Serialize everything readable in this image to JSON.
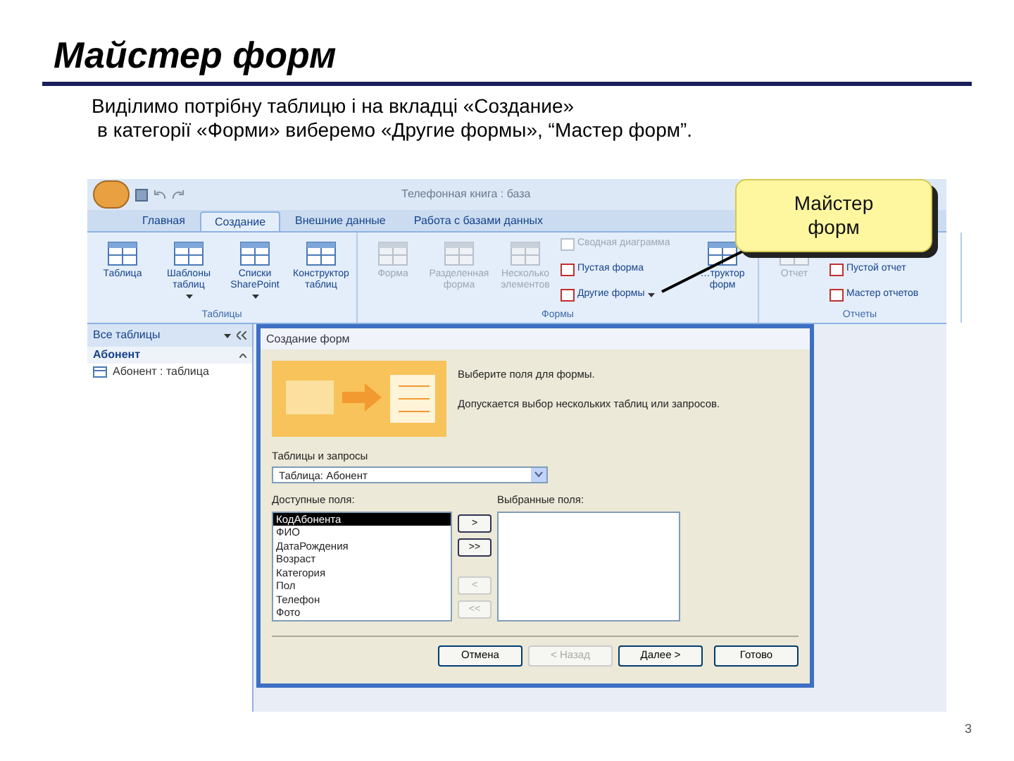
{
  "slide": {
    "title": "Майстер форм",
    "intro": [
      "Виділимо потрібну таблицю і на вкладці «Создание»",
      "в категорії «Форми» виберемо «Другие формы», “Мастер форм”."
    ],
    "page_number": "3"
  },
  "app": {
    "window_title": "Телефонная книга : база",
    "tabs": [
      {
        "label": "Главная",
        "selected": false
      },
      {
        "label": "Создание",
        "selected": true
      },
      {
        "label": "Внешние данные",
        "selected": false
      },
      {
        "label": "Работа с базами данных",
        "selected": false
      }
    ],
    "groups": [
      {
        "label": "Таблицы",
        "buttons": [
          {
            "label": "Таблица",
            "kind": "large",
            "disabled": false,
            "has_menu": false
          },
          {
            "label": "Шаблоны таблиц",
            "kind": "large",
            "disabled": false,
            "has_menu": true
          },
          {
            "label": "Списки SharePoint",
            "kind": "large",
            "disabled": false,
            "has_menu": true
          },
          {
            "label": "Конструктор таблиц",
            "kind": "large",
            "disabled": false,
            "has_menu": false
          }
        ]
      },
      {
        "label": "Формы",
        "buttons": [
          {
            "label": "Форма",
            "kind": "large",
            "disabled": true,
            "has_menu": false
          },
          {
            "label": "Разделенная форма",
            "kind": "large",
            "disabled": true,
            "has_menu": false
          },
          {
            "label": "Несколько элементов",
            "kind": "large",
            "disabled": true,
            "has_menu": false
          },
          {
            "label": "Сводная диаграмма",
            "kind": "small",
            "disabled": true,
            "has_menu": false
          },
          {
            "label": "Пустая форма",
            "kind": "small",
            "disabled": false,
            "has_menu": false
          },
          {
            "label": "Другие формы",
            "kind": "small",
            "disabled": false,
            "has_menu": true
          },
          {
            "label": "…труктор форм",
            "kind": "large",
            "disabled": false,
            "has_menu": false
          }
        ]
      },
      {
        "label": "Отчеты",
        "buttons": [
          {
            "label": "Отчет",
            "kind": "large",
            "disabled": true,
            "has_menu": false
          },
          {
            "label": "Пустой отчет",
            "kind": "small",
            "disabled": false,
            "has_menu": false
          },
          {
            "label": "Мастер отчетов",
            "kind": "small",
            "disabled": false,
            "has_menu": false
          }
        ]
      }
    ]
  },
  "callout": {
    "text": "Майстер форм"
  },
  "nav": {
    "title": "Все таблицы",
    "group": "Абонент",
    "item": "Абонент : таблица"
  },
  "dialog": {
    "title": "Создание форм",
    "prompt": "Выберите поля для формы.",
    "hint": "Допускается выбор нескольких таблиц или запросов.",
    "source_label": "Таблицы и запросы",
    "source_value": "Таблица: Абонент",
    "available_label": "Доступные поля:",
    "selected_label": "Выбранные поля:",
    "available_fields": [
      {
        "label": "КодАбонента",
        "selected": true
      },
      {
        "label": "ФИО",
        "selected": false
      },
      {
        "label": "ДатаРождения",
        "selected": false
      },
      {
        "label": "Возраст",
        "selected": false
      },
      {
        "label": "Категория",
        "selected": false
      },
      {
        "label": "Пол",
        "selected": false
      },
      {
        "label": "Телефон",
        "selected": false
      },
      {
        "label": "Фото",
        "selected": false
      }
    ],
    "move_buttons": [
      {
        "label": ">",
        "disabled": false
      },
      {
        "label": ">>",
        "disabled": false
      },
      {
        "label": "<",
        "disabled": true
      },
      {
        "label": "<<",
        "disabled": true
      }
    ],
    "footer_buttons": [
      {
        "label": "Отмена",
        "disabled": false
      },
      {
        "label": "< Назад",
        "disabled": true
      },
      {
        "label": "Далее >",
        "disabled": false
      },
      {
        "label": "Готово",
        "disabled": false
      }
    ]
  }
}
